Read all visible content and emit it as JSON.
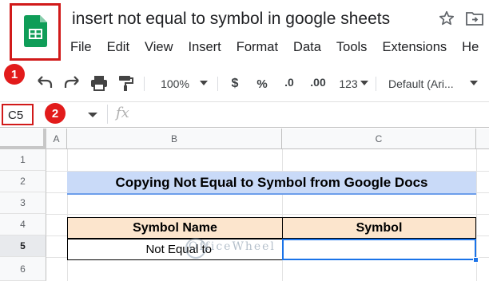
{
  "window": {
    "title": "insert not equal to symbol in google sheets"
  },
  "menu": [
    "File",
    "Edit",
    "View",
    "Insert",
    "Format",
    "Data",
    "Tools",
    "Extensions",
    "He"
  ],
  "toolbar": {
    "zoom": "100%",
    "currency": "$",
    "percent": "%",
    "decrease_decimal": ".0",
    "increase_decimal": ".00",
    "more_formats": "123",
    "font": "Default (Ari..."
  },
  "badges": [
    "1",
    "2"
  ],
  "formula_bar": {
    "cell_ref": "C5",
    "fx": "fx",
    "value": ""
  },
  "grid": {
    "columns": [
      "A",
      "B",
      "C"
    ],
    "rows": [
      "1",
      "2",
      "3",
      "4",
      "5",
      "6"
    ],
    "active_row": "5"
  },
  "sheet": {
    "title": "Copying Not Equal to Symbol from Google Docs",
    "headers": [
      "Symbol Name",
      "Symbol"
    ],
    "row": [
      "Not Equal to",
      ""
    ]
  },
  "watermark": "OfficeWheel",
  "colors": {
    "title_fill": "#c9daf8",
    "header_fill": "#fce5cd",
    "selection": "#1a73e8",
    "callout": "#e21b1b"
  }
}
